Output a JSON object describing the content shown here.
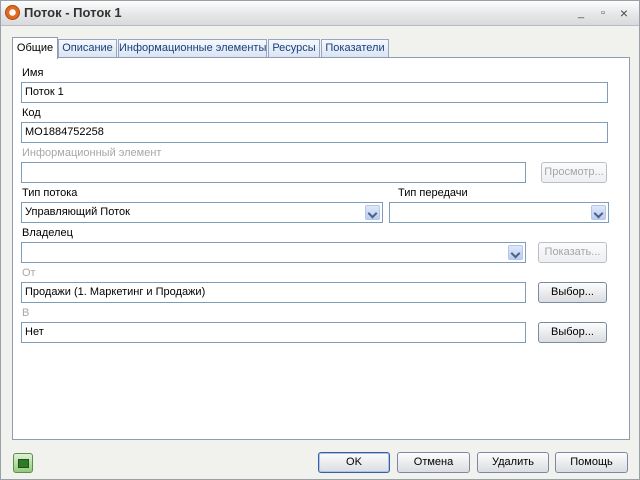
{
  "window": {
    "title": "Поток - Поток 1",
    "controls": {
      "minimize": "_",
      "maximize": "▫",
      "close": "×"
    }
  },
  "tabs": [
    {
      "label": "Общие",
      "active": true
    },
    {
      "label": "Описание",
      "active": false
    },
    {
      "label": "Информационные элементы",
      "active": false
    },
    {
      "label": "Ресурсы",
      "active": false
    },
    {
      "label": "Показатели",
      "active": false
    }
  ],
  "form": {
    "name": {
      "label": "Имя",
      "value": "Поток 1"
    },
    "code": {
      "label": "Код",
      "value": "MO1884752258"
    },
    "info_element": {
      "label": "Информационный элемент",
      "value": "",
      "button": "Просмотр..."
    },
    "flow_type": {
      "label": "Тип потока",
      "value": "Управляющий Поток"
    },
    "transfer_type": {
      "label": "Тип передачи",
      "value": ""
    },
    "owner": {
      "label": "Владелец",
      "value": "",
      "button": "Показать..."
    },
    "from": {
      "label": "От",
      "value": "Продажи (1. Маркетинг и Продажи)",
      "button": "Выбор..."
    },
    "to": {
      "label": "В",
      "value": "Нет",
      "button": "Выбор..."
    }
  },
  "footer": {
    "ok": "OK",
    "cancel": "Отмена",
    "delete": "Удалить",
    "help": "Помощь",
    "icon": "book-icon"
  },
  "colors": {
    "tab_text": "#1a3f7a",
    "field_border": "#7f9db9",
    "disabled_text": "#a7a7a7"
  }
}
